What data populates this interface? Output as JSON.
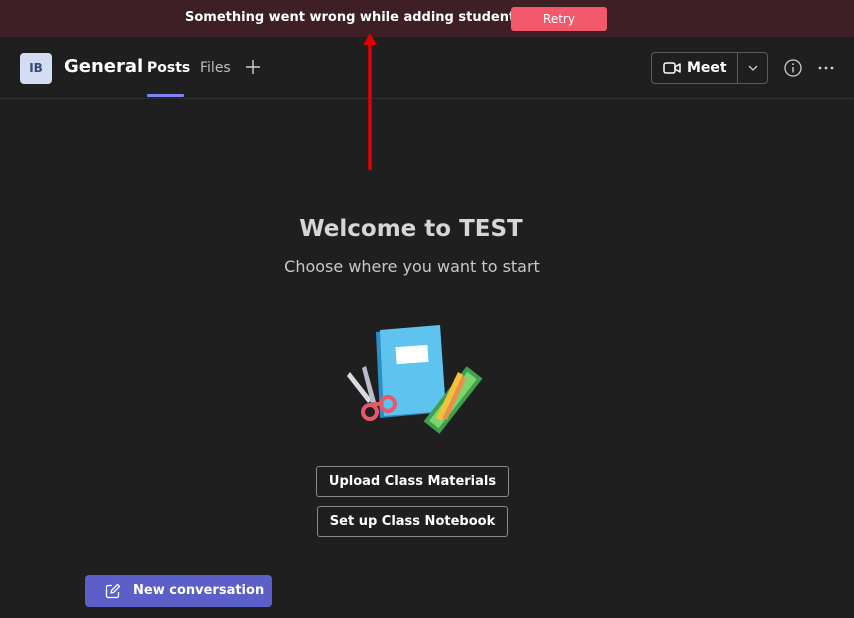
{
  "banner": {
    "message": "Something went wrong while adding students.",
    "retry_label": "Retry"
  },
  "header": {
    "avatar_initials": "IB",
    "channel_name": "General",
    "tabs": [
      {
        "label": "Posts",
        "active": true
      },
      {
        "label": "Files",
        "active": false
      }
    ],
    "meet_label": "Meet"
  },
  "main": {
    "title": "Welcome to TEST",
    "subtitle": "Choose where you want to start",
    "actions": [
      {
        "label": "Upload Class Materials"
      },
      {
        "label": "Set up Class Notebook"
      }
    ],
    "new_conversation_label": "New conversation"
  },
  "colors": {
    "accent": "#5b5fc7",
    "banner_bg": "#3e1f25",
    "retry_bg": "#f25a6b",
    "annotation": "#e00000"
  }
}
